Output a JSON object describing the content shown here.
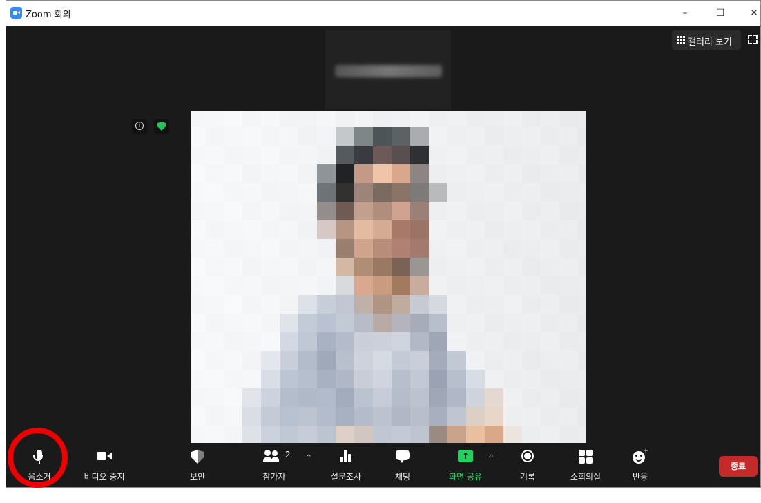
{
  "window": {
    "title": "Zoom 회의",
    "minimize_glyph": "–",
    "maximize_glyph": "☐",
    "close_glyph": "✕"
  },
  "header": {
    "gallery_label": "갤러리 보기"
  },
  "toolbar": {
    "mute_label": "음소거",
    "video_label": "비디오 중지",
    "security_label": "보안",
    "participants_label": "참가자",
    "participants_count": "2",
    "polls_label": "설문조사",
    "chat_label": "채팅",
    "share_label": "화면 공유",
    "record_label": "기록",
    "breakout_label": "소회의실",
    "reactions_label": "반응",
    "end_label": "종료",
    "caret_glyph": "^",
    "share_arrow_glyph": "↑",
    "plus_glyph": "+"
  },
  "colors": {
    "accent_share": "#23d160",
    "end_button": "#c52a2a",
    "highlight_ring": "#ee0000",
    "security_badge": "#23c35a",
    "app_icon": "#2d8cff"
  },
  "icons": [
    "zoom-app-icon",
    "grid-icon",
    "fullscreen-icon",
    "info-icon",
    "shield-check-icon",
    "microphone-icon",
    "video-camera-icon",
    "shield-icon",
    "participants-icon",
    "polls-bar-chart-icon",
    "chat-bubble-icon",
    "share-screen-arrow-icon",
    "record-icon",
    "breakout-rooms-icon",
    "reaction-emoji-icon"
  ]
}
